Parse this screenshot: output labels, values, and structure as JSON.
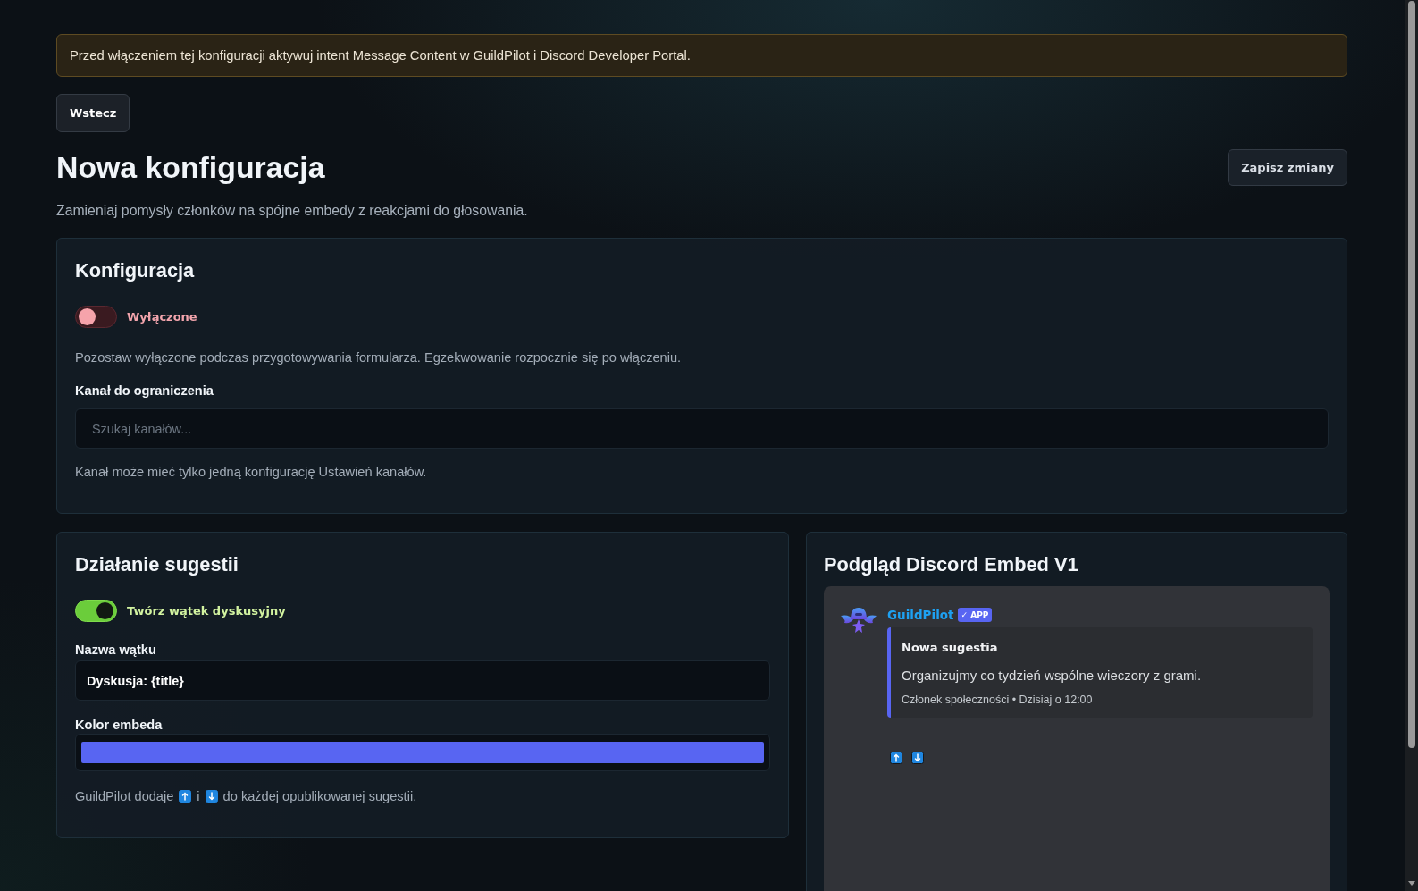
{
  "notice": {
    "text": "Przed włączeniem tej konfiguracji aktywuj intent Message Content w GuildPilot i Discord Developer Portal."
  },
  "back_button": {
    "label": "Wstecz"
  },
  "header": {
    "title": "Nowa konfiguracja",
    "save_button": {
      "label": "Zapisz zmiany"
    },
    "subtitle": "Zamieniaj pomysły członków na spójne embedy z reakcjami do głosowania."
  },
  "configuration": {
    "title": "Konfiguracja",
    "toggle": {
      "label": "Wyłączone",
      "on": false
    },
    "hint": "Pozostaw wyłączone podczas przygotowywania formularza. Egzekwowanie rozpocznie się po włączeniu.",
    "channel_field": {
      "label": "Kanał do ograniczenia",
      "placeholder": "Szukaj kanałów..."
    },
    "channel_hint": "Kanał może mieć tylko jedną konfigurację Ustawień kanałów."
  },
  "suggestion_behavior": {
    "title": "Działanie sugestii",
    "thread_toggle": {
      "label": "Twórz wątek dyskusyjny",
      "on": true
    },
    "thread_name": {
      "label": "Nazwa wątku",
      "value": "Dyskusja: {title}"
    },
    "embed_color": {
      "label": "Kolor embeda",
      "color": "#5865f2"
    },
    "reactions_note": {
      "before": "GuildPilot dodaje",
      "between": "i",
      "after": "do każdej opublikowanej sugestii."
    }
  },
  "preview": {
    "title": "Podgląd Discord Embed V1",
    "author": {
      "name": "GuildPilot",
      "badge": "✓ APP"
    },
    "embed": {
      "title": "Nowa sugestia",
      "description": "Organizujmy co tydzień wspólne wieczory z grami.",
      "footer": "Członek społeczności • Dzisiaj o 12:00"
    }
  }
}
